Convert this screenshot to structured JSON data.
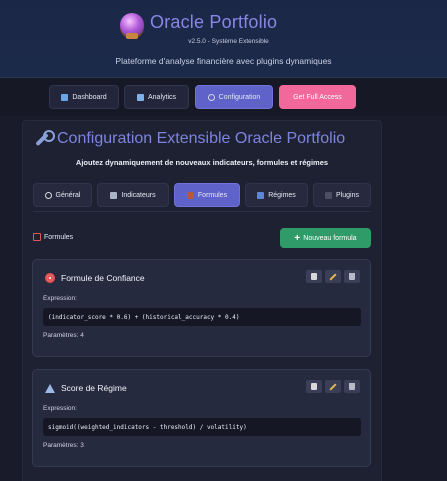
{
  "header": {
    "title": "Oracle Portfolio",
    "version": "v2.5.0 - Système Extensible",
    "subtitle": "Plateforme d'analyse financière avec plugins dynamiques"
  },
  "nav": [
    {
      "label": "Dashboard",
      "icon": "chart-icon"
    },
    {
      "label": "Analytics",
      "icon": "chart-up-icon"
    },
    {
      "label": "Configuration",
      "icon": "gear-icon",
      "active": true
    },
    {
      "label": "Get Full Access",
      "accent": "#f0699a"
    }
  ],
  "config": {
    "title": "Configuration Extensible Oracle Portfolio",
    "subtitle": "Ajoutez dynamiquement de nouveaux indicateurs, formules et régimes",
    "tabs": [
      {
        "label": "Général",
        "icon": "gear-icon"
      },
      {
        "label": "Indicateurs",
        "icon": "microscope-icon"
      },
      {
        "label": "Formules",
        "icon": "abacus-icon",
        "active": true
      },
      {
        "label": "Régimes",
        "icon": "bar-chart-icon"
      },
      {
        "label": "Plugins",
        "icon": "plug-icon"
      }
    ],
    "section_label": "Formules",
    "new_button": "Nouveau formula"
  },
  "formulas": [
    {
      "name": "Formule de Confiance",
      "icon": "target-icon",
      "expression_label": "Expression:",
      "expression": "(indicator_score * 0.6) + (historical_accuracy * 0.4)",
      "params": "Paramètres: 4"
    },
    {
      "name": "Score de Régime",
      "icon": "triangle-ruler-icon",
      "expression_label": "Expression:",
      "expression": "sigmoid((weighted_indicators - threshold) / volatility)",
      "params": "Paramètres: 3"
    }
  ],
  "colors": {
    "accent": "#5f62c9",
    "title": "#7d84e0",
    "success": "#2f9b69",
    "cta": "#f0699a"
  }
}
